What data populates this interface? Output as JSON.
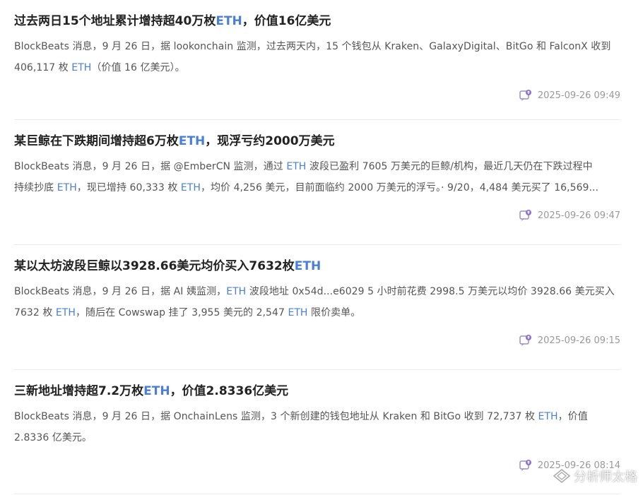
{
  "accent_color": "#4a7fd6",
  "items": [
    {
      "title_pre": "过去两日15个地址累计增持超40万枚",
      "title_eth": "ETH",
      "title_post": "，价值16亿美元",
      "body_lines": [
        [
          {
            "t": "BlockBeats 消息，9 月 26 日，据 lookonchain 监测，过去两天内，15 个钱包从 Kraken、GalaxyDigital、BitGo 和 FalconX 收到",
            "eth": false
          }
        ],
        [
          {
            "t": "406,117 枚 ",
            "eth": false
          },
          {
            "t": "ETH",
            "eth": true
          },
          {
            "t": "（价值 16 亿美元）。",
            "eth": false
          }
        ]
      ],
      "time": "2025-09-26 09:49"
    },
    {
      "title_pre": "某巨鲸在下跌期间增持超6万枚",
      "title_eth": "ETH",
      "title_post": "，现浮亏约2000万美元",
      "body_lines": [
        [
          {
            "t": "BlockBeats 消息，9 月 26 日，据 @EmberCN 监测，通过 ",
            "eth": false
          },
          {
            "t": "ETH",
            "eth": true
          },
          {
            "t": " 波段已盈利 7605 万美元的巨鲸/机构，最近几天仍在下跌过程中",
            "eth": false
          }
        ],
        [
          {
            "t": "持续抄底 ",
            "eth": false
          },
          {
            "t": "ETH",
            "eth": true
          },
          {
            "t": "，现已增持 60,333 枚 ",
            "eth": false
          },
          {
            "t": "ETH",
            "eth": true
          },
          {
            "t": "，均价 4,256 美元，目前面临约 2000 万美元的浮亏。· 9/20，4,484 美元买了 16,569...",
            "eth": false
          }
        ]
      ],
      "time": "2025-09-26 09:47"
    },
    {
      "title_pre": "某以太坊波段巨鲸以3928.66美元均价买入7632枚",
      "title_eth": "ETH",
      "title_post": "",
      "body_lines": [
        [
          {
            "t": "BlockBeats 消息，9 月 26 日，据 AI 姨监测，",
            "eth": false
          },
          {
            "t": "ETH",
            "eth": true
          },
          {
            "t": " 波段地址 0x54d...e6029 5 小时前花费 2998.5 万美元以均价 3928.66 美元买入",
            "eth": false
          }
        ],
        [
          {
            "t": "7632 枚 ",
            "eth": false
          },
          {
            "t": "ETH",
            "eth": true
          },
          {
            "t": "，随后在 Cowswap 挂了 3,955 美元的 2,547 ",
            "eth": false
          },
          {
            "t": "ETH",
            "eth": true
          },
          {
            "t": " 限价卖单。",
            "eth": false
          }
        ]
      ],
      "time": "2025-09-26 09:15"
    },
    {
      "title_pre": "三新地址增持超7.2万枚",
      "title_eth": "ETH",
      "title_post": "，价值2.8336亿美元",
      "body_lines": [
        [
          {
            "t": "BlockBeats 消息，9 月 26 日，据 OnchainLens 监测，3 个新创建的钱包地址从 Kraken 和 BitGo 收到 72,737 枚 ",
            "eth": false
          },
          {
            "t": "ETH",
            "eth": true
          },
          {
            "t": "，价值",
            "eth": false
          }
        ],
        [
          {
            "t": "2.8336 亿美元。",
            "eth": false
          }
        ]
      ],
      "time": "2025-09-26 08:14"
    }
  ],
  "watermark": "分析师太格",
  "icons": {
    "share": "share-icon",
    "watermark": "watermark-logo-icon"
  }
}
